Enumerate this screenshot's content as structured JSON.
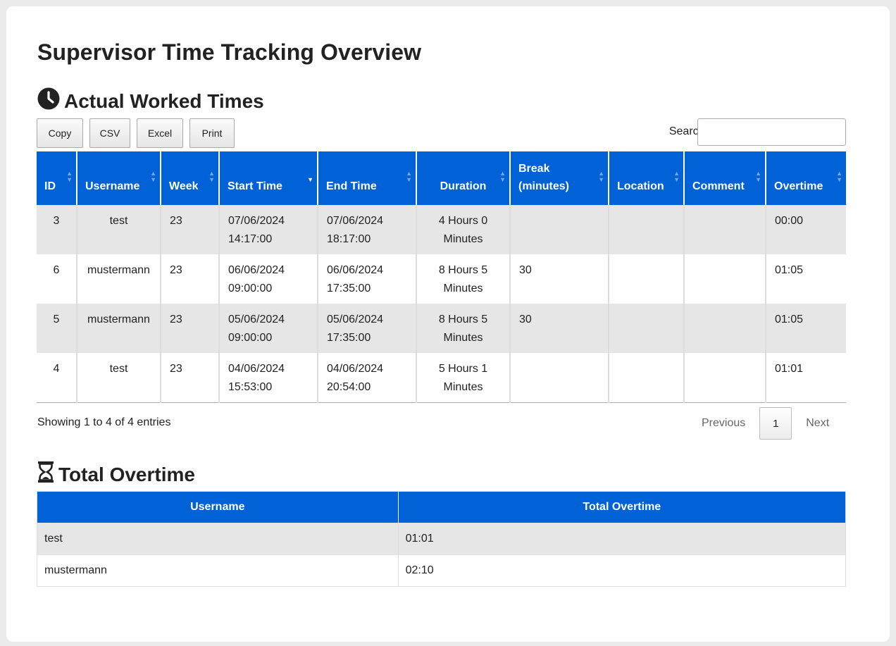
{
  "page_title": "Supervisor Time Tracking Overview",
  "worked": {
    "title": "Actual Worked Times",
    "icon": "clock-icon",
    "buttons": {
      "copy": "Copy",
      "csv": "CSV",
      "excel": "Excel",
      "print": "Print"
    },
    "search": {
      "label": "Search:",
      "value": ""
    },
    "columns": [
      "ID",
      "Username",
      "Week",
      "Start Time",
      "End Time",
      "Duration",
      "Break (minutes)",
      "Location",
      "Comment",
      "Overtime"
    ],
    "sorted_column": "Start Time",
    "sort_direction": "desc",
    "rows": [
      {
        "id": "3",
        "username": "test",
        "week": "23",
        "start": "07/06/2024 14:17:00",
        "end": "07/06/2024 18:17:00",
        "duration": "4 Hours 0 Minutes",
        "break": "",
        "location": "",
        "comment": "",
        "overtime": "00:00"
      },
      {
        "id": "6",
        "username": "mustermann",
        "week": "23",
        "start": "06/06/2024 09:00:00",
        "end": "06/06/2024 17:35:00",
        "duration": "8 Hours 5 Minutes",
        "break": "30",
        "location": "",
        "comment": "",
        "overtime": "01:05"
      },
      {
        "id": "5",
        "username": "mustermann",
        "week": "23",
        "start": "05/06/2024 09:00:00",
        "end": "05/06/2024 17:35:00",
        "duration": "8 Hours 5 Minutes",
        "break": "30",
        "location": "",
        "comment": "",
        "overtime": "01:05"
      },
      {
        "id": "4",
        "username": "test",
        "week": "23",
        "start": "04/06/2024 15:53:00",
        "end": "04/06/2024 20:54:00",
        "duration": "5 Hours 1 Minutes",
        "break": "",
        "location": "",
        "comment": "",
        "overtime": "01:01"
      }
    ],
    "info": "Showing 1 to 4 of 4 entries",
    "pagination": {
      "previous": "Previous",
      "current": "1",
      "next": "Next"
    }
  },
  "overtime": {
    "title": "Total Overtime",
    "icon": "hourglass-icon",
    "columns": [
      "Username",
      "Total Overtime"
    ],
    "rows": [
      {
        "username": "test",
        "total": "01:01"
      },
      {
        "username": "mustermann",
        "total": "02:10"
      }
    ]
  },
  "colors": {
    "header_bg": "#0062d6",
    "odd_row": "#e6e6e6",
    "page_bg": "#ececec"
  }
}
